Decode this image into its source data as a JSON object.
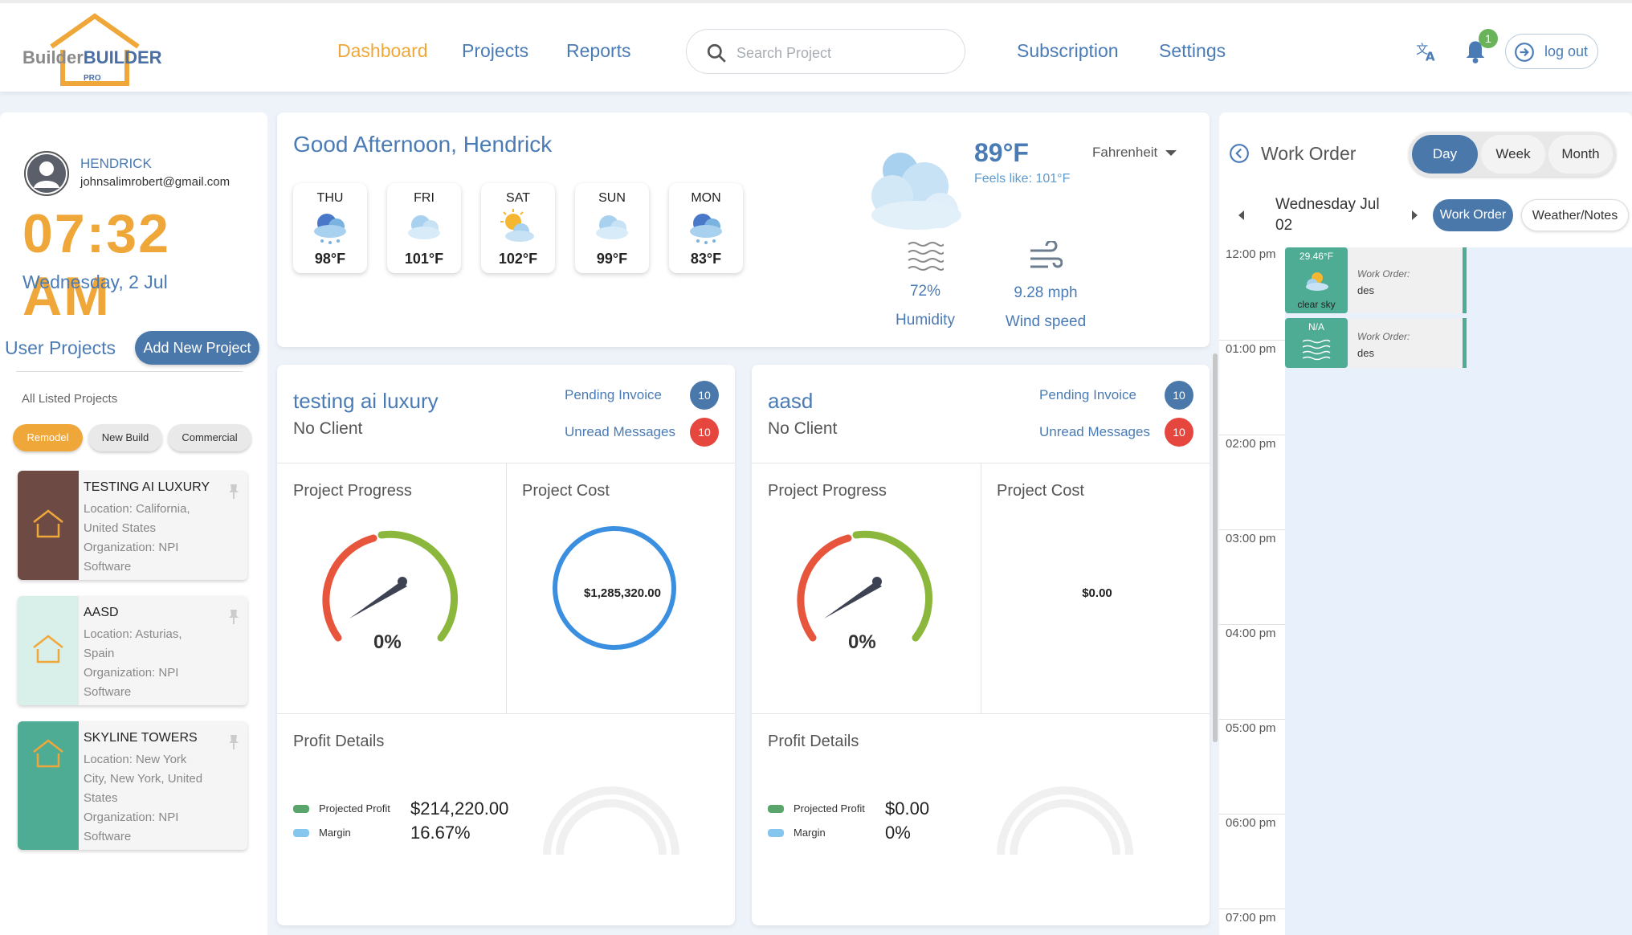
{
  "brand": {
    "logo_text_a": "Builder",
    "logo_text_b": "BUILDER",
    "logo_tag": "PRO",
    "brand_orange": "#f0a73a",
    "brand_blue": "#4a7bb5"
  },
  "nav": {
    "items": [
      {
        "label": "Dashboard",
        "active": true
      },
      {
        "label": "Projects",
        "active": false
      },
      {
        "label": "Reports",
        "active": false
      },
      {
        "label": "Subscription",
        "active": false
      },
      {
        "label": "Settings",
        "active": false
      }
    ],
    "search_placeholder": "Search Project",
    "notification_count": "1",
    "logout_label": "log out"
  },
  "user": {
    "name": "HENDRICK",
    "email": "johnsalimrobert@gmail.com",
    "time": "07:32 AM",
    "date": "Wednesday, 2 Jul"
  },
  "projects_panel": {
    "title": "User Projects",
    "add_button": "Add New Project",
    "all_listed": "All Listed Projects",
    "filters": [
      {
        "label": "Remodel",
        "active": true
      },
      {
        "label": "New Build",
        "active": false
      },
      {
        "label": "Commercial",
        "active": false
      }
    ],
    "projects": [
      {
        "name": "TESTING AI LUXURY",
        "location": "Location: California, United States",
        "organization": "Organization: NPI Software",
        "color": "#6d4b44"
      },
      {
        "name": "AASD",
        "location": "Location: Asturias, Spain",
        "organization": "Organization: NPI Software",
        "color": "#d9efea"
      },
      {
        "name": "SKYLINE TOWERS",
        "location": "Location: New York City, New York, United States",
        "organization": "Organization: NPI Software",
        "color": "#4fac94"
      }
    ]
  },
  "weather": {
    "greeting": "Good Afternoon, Hendrick",
    "forecast": [
      {
        "day": "THU",
        "temp": "98°F",
        "icon": "rain-cloud-icon"
      },
      {
        "day": "FRI",
        "temp": "101°F",
        "icon": "cloud-icon"
      },
      {
        "day": "SAT",
        "temp": "102°F",
        "icon": "sun-cloud-icon"
      },
      {
        "day": "SUN",
        "temp": "99°F",
        "icon": "cloud-icon"
      },
      {
        "day": "MON",
        "temp": "83°F",
        "icon": "rain-cloud-icon"
      }
    ],
    "current_temp": "89°F",
    "feels_like": "Feels like: 101°F",
    "unit": "Fahrenheit",
    "humidity_value": "72%",
    "humidity_label": "Humidity",
    "wind_value": "9.28 mph",
    "wind_label": "Wind speed"
  },
  "project_cards": [
    {
      "name": "testing ai luxury",
      "client": "No Client",
      "pending_invoice_label": "Pending Invoice",
      "pending_invoice_count": "10",
      "unread_messages_label": "Unread Messages",
      "unread_messages_count": "10",
      "progress_title": "Project Progress",
      "progress_value": "0%",
      "cost_title": "Project Cost",
      "cost_value": "$1,285,320.00",
      "profit_title": "Profit Details",
      "projected_profit_label": "Projected Profit",
      "projected_profit_value": "$214,220.00",
      "margin_label": "Margin",
      "margin_value": "16.67%"
    },
    {
      "name": "aasd",
      "client": "No Client",
      "pending_invoice_label": "Pending Invoice",
      "pending_invoice_count": "10",
      "unread_messages_label": "Unread Messages",
      "unread_messages_count": "10",
      "progress_title": "Project Progress",
      "progress_value": "0%",
      "cost_title": "Project Cost",
      "cost_value": "$0.00",
      "profit_title": "Profit Details",
      "projected_profit_label": "Projected Profit",
      "projected_profit_value": "$0.00",
      "margin_label": "Margin",
      "margin_value": "0%"
    }
  ],
  "work_order": {
    "title": "Work Order",
    "views": [
      {
        "label": "Day",
        "active": true
      },
      {
        "label": "Week",
        "active": false
      },
      {
        "label": "Month",
        "active": false
      }
    ],
    "date_line1": "Wednesday Jul",
    "date_line2": "02",
    "tabs": [
      {
        "label": "Work Order",
        "active": true
      },
      {
        "label": "Weather/Notes",
        "active": false
      }
    ],
    "hours": [
      "12:00 pm",
      "01:00 pm",
      "02:00 pm",
      "03:00 pm",
      "04:00 pm",
      "05:00 pm",
      "06:00 pm",
      "07:00 pm"
    ],
    "events": [
      {
        "temp": "29.46°F",
        "condition": "clear sky",
        "label": "Work Order:",
        "desc": "des"
      },
      {
        "temp": "N/A",
        "condition": "",
        "label": "Work Order:",
        "desc": "des"
      }
    ]
  }
}
